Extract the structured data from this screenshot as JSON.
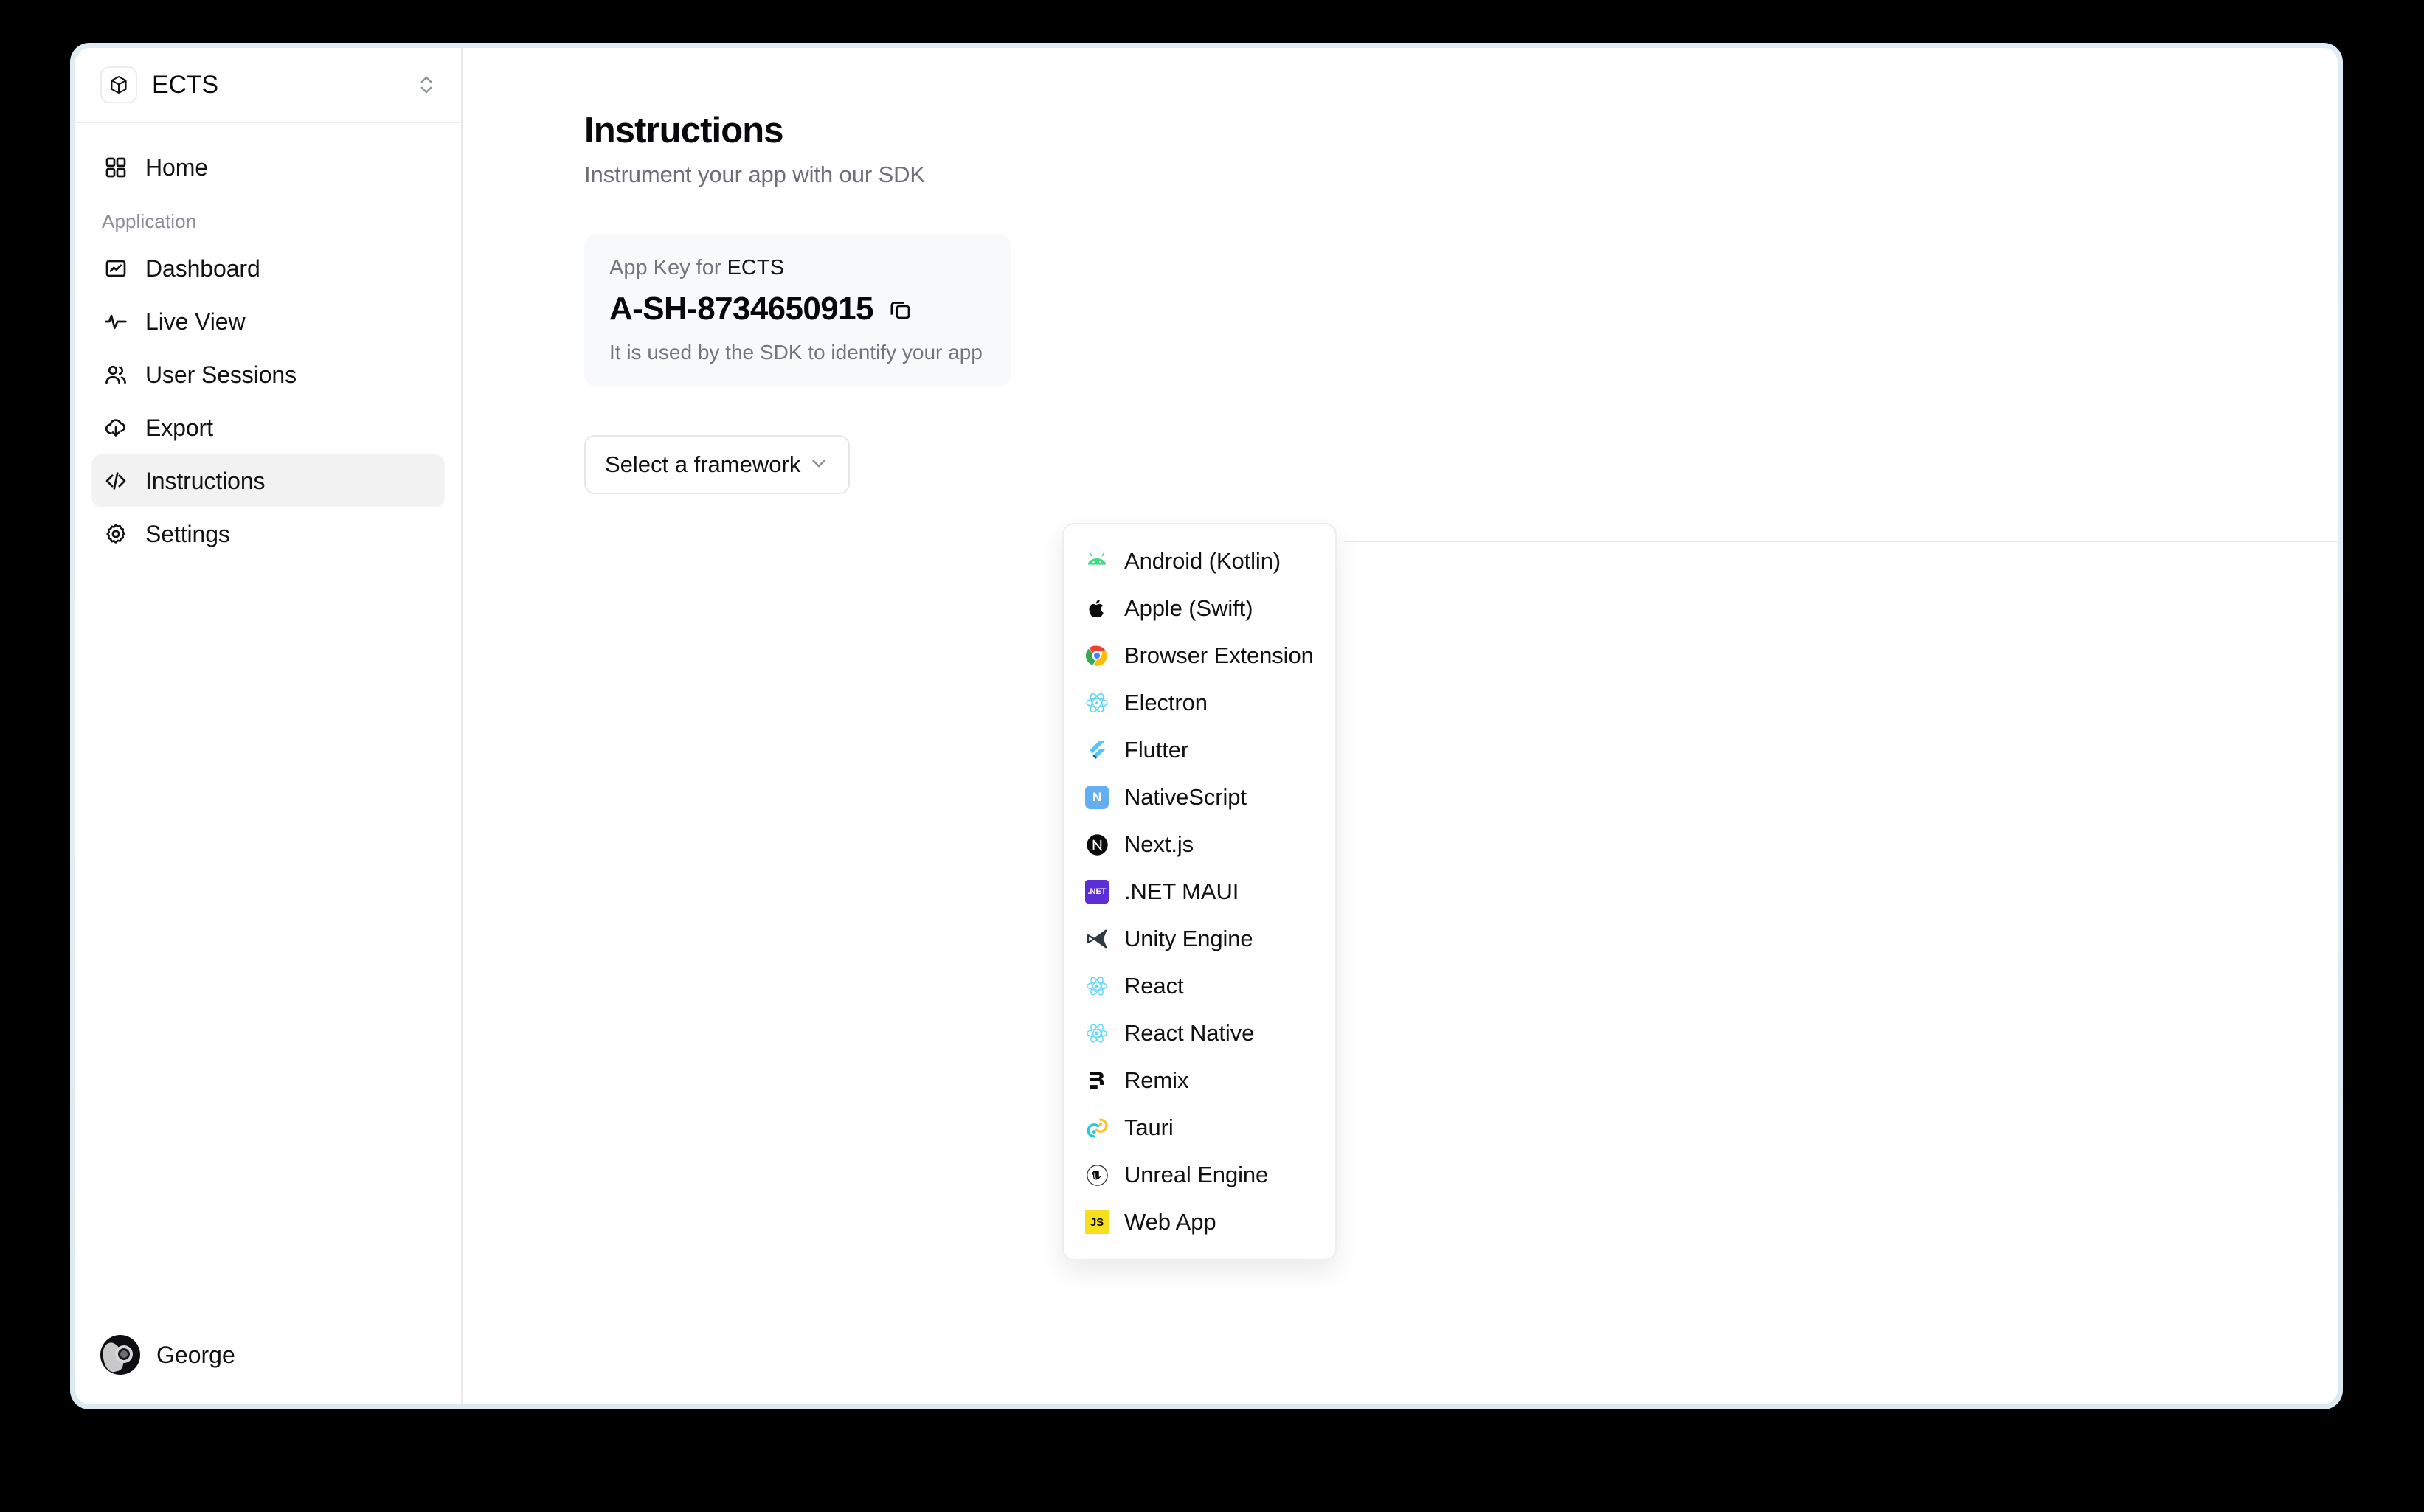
{
  "workspace": {
    "name": "ECTS",
    "icon": "cube-icon",
    "switcher_icon": "chevron-up-down-icon"
  },
  "sidebar": {
    "top_items": [
      {
        "label": "Home",
        "icon": "grid-icon"
      }
    ],
    "section_label": "Application",
    "items": [
      {
        "label": "Dashboard",
        "icon": "chart-square-icon",
        "active": false
      },
      {
        "label": "Live View",
        "icon": "pulse-icon",
        "active": false
      },
      {
        "label": "User Sessions",
        "icon": "users-icon",
        "active": false
      },
      {
        "label": "Export",
        "icon": "cloud-download-icon",
        "active": false
      },
      {
        "label": "Instructions",
        "icon": "code-icon",
        "active": true
      },
      {
        "label": "Settings",
        "icon": "gear-icon",
        "active": false
      }
    ],
    "user": {
      "name": "George",
      "avatar": "user-avatar"
    }
  },
  "main": {
    "title": "Instructions",
    "subtitle": "Instrument your app with our SDK",
    "app_key_card": {
      "label_prefix": "App Key for",
      "label_app": "ECTS",
      "value": "A-SH-8734650915",
      "copy_icon": "copy-icon",
      "hint": "It is used by the SDK to identify your app"
    },
    "framework_select": {
      "placeholder": "Select a framework",
      "chevron_icon": "chevron-down-icon",
      "options": [
        {
          "label": "Android (Kotlin)",
          "icon": "android-icon"
        },
        {
          "label": "Apple (Swift)",
          "icon": "apple-icon"
        },
        {
          "label": "Browser Extension",
          "icon": "chrome-icon"
        },
        {
          "label": "Electron",
          "icon": "electron-icon"
        },
        {
          "label": "Flutter",
          "icon": "flutter-icon"
        },
        {
          "label": "NativeScript",
          "icon": "nativescript-icon"
        },
        {
          "label": "Next.js",
          "icon": "nextjs-icon"
        },
        {
          "label": ".NET MAUI",
          "icon": "dotnet-maui-icon"
        },
        {
          "label": "Unity Engine",
          "icon": "unity-icon"
        },
        {
          "label": "React",
          "icon": "react-icon"
        },
        {
          "label": "React Native",
          "icon": "react-native-icon"
        },
        {
          "label": "Remix",
          "icon": "remix-icon"
        },
        {
          "label": "Tauri",
          "icon": "tauri-icon"
        },
        {
          "label": "Unreal Engine",
          "icon": "unreal-icon"
        },
        {
          "label": "Web App",
          "icon": "javascript-icon"
        }
      ]
    }
  },
  "colors": {
    "frame": "#dfecf3",
    "active_nav": "#f2f2f3",
    "card_bg": "#f8f9fb",
    "muted_text": "#74747d",
    "android_green": "#3ddc84",
    "chrome_red": "#ea4335",
    "chrome_yellow": "#fbbc05",
    "chrome_green": "#34a853",
    "chrome_blue": "#4285f4",
    "electron_cyan": "#5fd4f4",
    "flutter_blue": "#54c5f8",
    "nativescript_blue": "#65adf1",
    "dotnet_purple": "#5c2ed6",
    "react_cyan": "#61dafb",
    "tauri_yellow": "#ffc131",
    "tauri_cyan": "#24c8db",
    "js_yellow": "#f7df1e"
  }
}
